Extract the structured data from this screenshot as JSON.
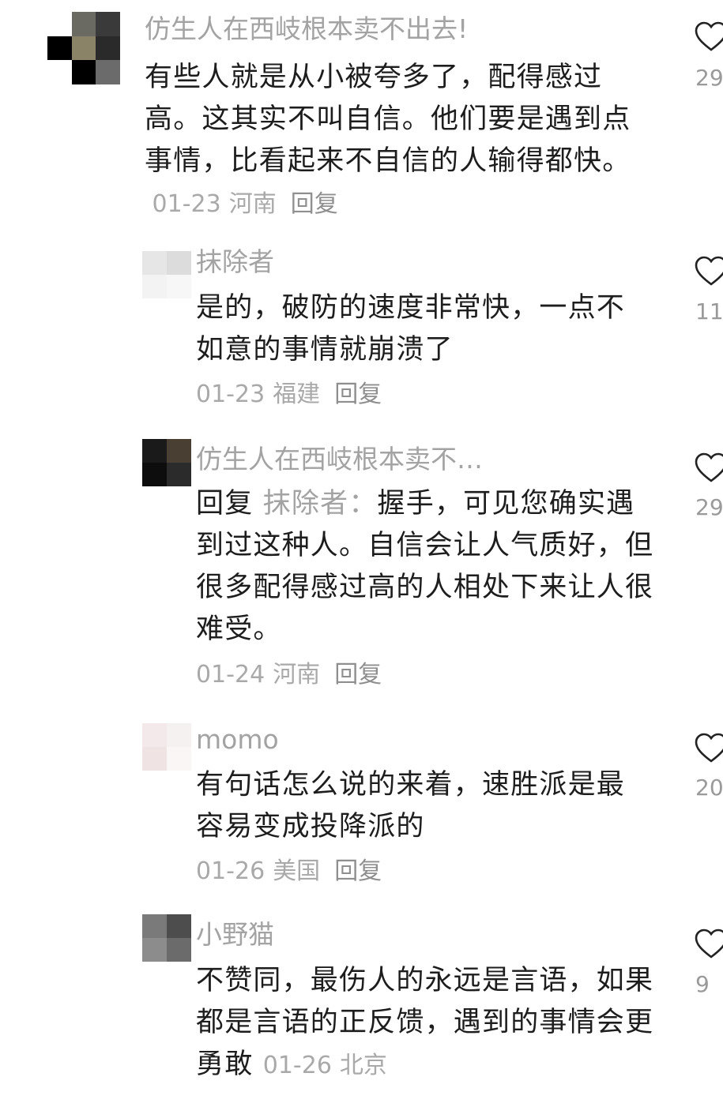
{
  "comments": [
    {
      "username": "仿生人在西岐根本卖不出去!",
      "text": "有些人就是从小被夸多了，配得感过高。这其实不叫自信。他们要是遇到点事情，比看起来不自信的人输得都快。",
      "date": "01-23",
      "location": "河南",
      "reply_label": "回复",
      "like_count": "29"
    },
    {
      "username": "抹除者",
      "text": "是的，破防的速度非常快，一点不如意的事情就崩溃了",
      "date": "01-23",
      "location": "福建",
      "reply_label": "回复",
      "like_count": "11"
    },
    {
      "username": "仿生人在西岐根本卖不…",
      "reply_prefix": "回复",
      "reply_to": "抹除者：",
      "text": "握手，可见您确实遇到过这种人。自信会让人气质好，但很多配得感过高的人相处下来让人很难受。",
      "date": "01-24",
      "location": "河南",
      "reply_label": "回复",
      "like_count": "29"
    },
    {
      "username": "momo",
      "text": "有句话怎么说的来着，速胜派是最容易变成投降派的",
      "date": "01-26",
      "location": "美国",
      "reply_label": "回复",
      "like_count": "20"
    },
    {
      "username": "小野猫",
      "text": "不赞同，最伤人的永远是言语，如果都是言语的正反馈，遇到的事情会更勇敢",
      "date": "01-26",
      "location": "北京",
      "like_count": "9"
    }
  ],
  "icons": {
    "like": "heart-outline-icon"
  },
  "colors": {
    "text": "#1d1d1d",
    "secondary": "#a3a3a3",
    "reply": "#8f8f8f"
  }
}
